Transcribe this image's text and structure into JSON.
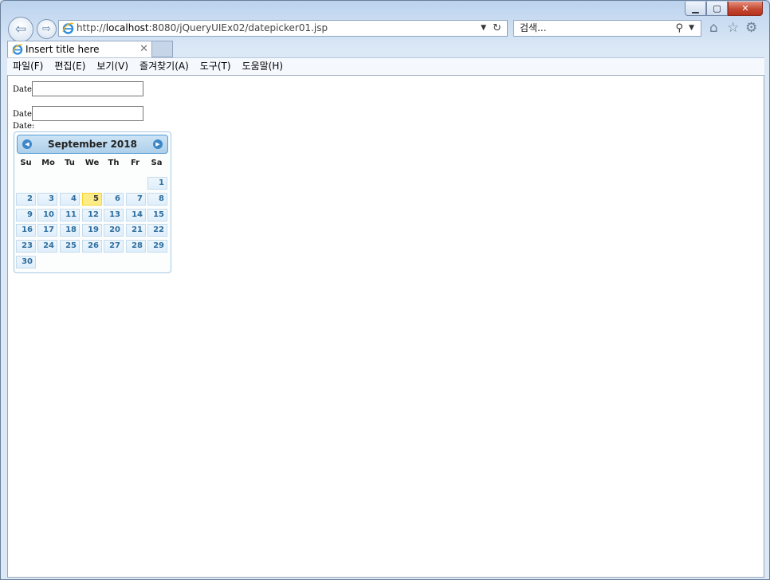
{
  "browser": {
    "address": {
      "url_prefix": "http://",
      "url_host": "localhost",
      "url_rest": ":8080/jQueryUIEx02/datepicker01.jsp"
    },
    "search": {
      "placeholder": "검색..."
    },
    "tab": {
      "title": "Insert title here"
    },
    "menu": [
      "파일(F)",
      "편집(E)",
      "보기(V)",
      "즐겨찾기(A)",
      "도구(T)",
      "도움말(H)"
    ]
  },
  "page": {
    "fields": [
      {
        "label": "Date:"
      },
      {
        "label": "Date:"
      },
      {
        "label": "Date:"
      }
    ]
  },
  "calendar": {
    "title": "September 2018",
    "weekdays": [
      "Su",
      "Mo",
      "Tu",
      "We",
      "Th",
      "Fr",
      "Sa"
    ],
    "first_weekday_index": 6,
    "days_in_month": 30,
    "highlighted_day": 5
  }
}
